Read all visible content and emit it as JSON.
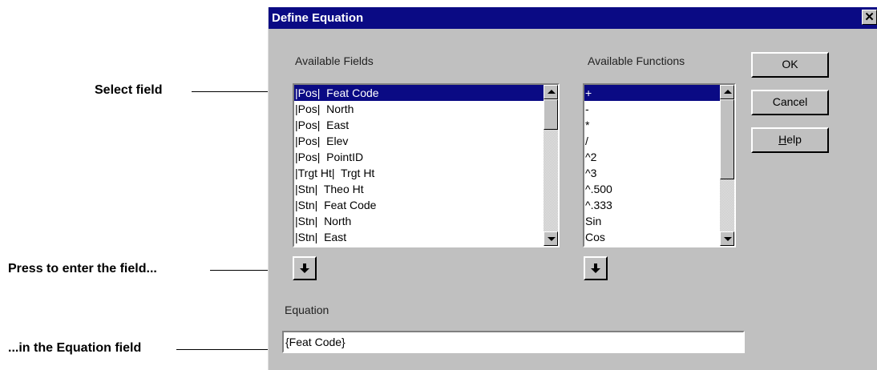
{
  "annotations": {
    "select_field": "Select field",
    "press_enter": "Press to enter the field...",
    "in_equation": "...in the Equation field"
  },
  "dialog": {
    "title": "Define Equation",
    "close_glyph": "✕",
    "available_fields_label": "Available Fields",
    "available_functions_label": "Available Functions",
    "fields": [
      "|Pos|  Feat Code",
      "|Pos|  North",
      "|Pos|  East",
      "|Pos|  Elev",
      "|Pos|  PointID",
      "|Trgt Ht|  Trgt Ht",
      "|Stn|  Theo Ht",
      "|Stn|  Feat Code",
      "|Stn|  North",
      "|Stn|  East"
    ],
    "selected_field_index": 0,
    "functions": [
      "+",
      "-",
      "*",
      "/",
      "^2",
      "^3",
      "^.500",
      "^.333",
      "Sin",
      "Cos"
    ],
    "selected_function_index": 0,
    "buttons": {
      "ok": "OK",
      "cancel": "Cancel",
      "help_underlined": "H",
      "help_rest": "elp"
    },
    "equation_label": "Equation",
    "equation_value": "{Feat Code}",
    "icons": {
      "insert_field": "down-arrow-icon",
      "insert_function": "down-arrow-icon"
    }
  }
}
